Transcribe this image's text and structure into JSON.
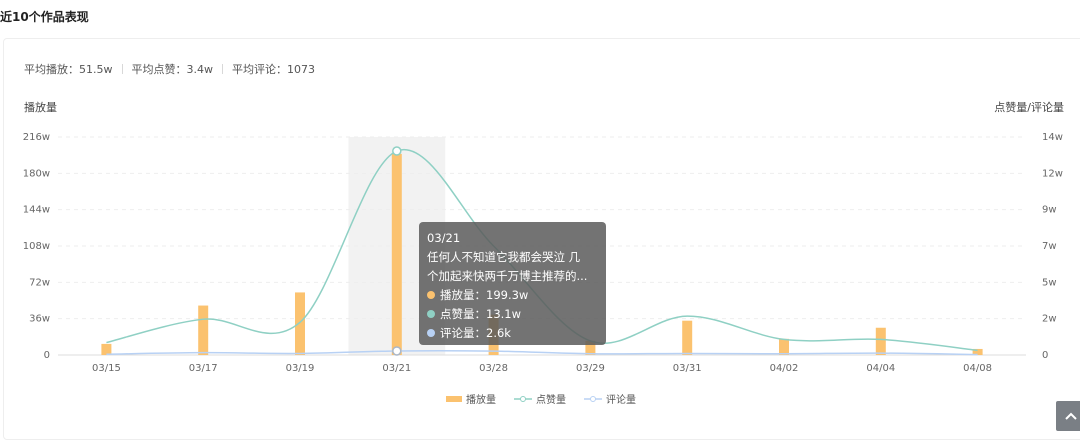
{
  "section_title": "近10个作品表现",
  "stats": {
    "avg_play": "平均播放：51.5w",
    "avg_like": "平均点赞：3.4w",
    "avg_comment": "平均评论：1073"
  },
  "left_axis_title": "播放量",
  "right_axis_title": "点赞量/评论量",
  "colors": {
    "play": "#fbc26f",
    "like": "#8fd0c4",
    "comment": "#b8d1f4"
  },
  "chart_data": {
    "type": "bar",
    "categories": [
      "03/15",
      "03/17",
      "03/19",
      "03/21",
      "03/28",
      "03/29",
      "03/31",
      "04/02",
      "04/04",
      "04/08"
    ],
    "series": [
      {
        "name": "播放量",
        "axis": "left",
        "type": "bar",
        "values": [
          11,
          49,
          62,
          199.3,
          40,
          14,
          34,
          16,
          27,
          6
        ]
      },
      {
        "name": "点赞量",
        "axis": "right",
        "type": "line",
        "values": [
          0.8,
          2.3,
          2.1,
          13.1,
          7.0,
          0.9,
          2.5,
          1.0,
          1.0,
          0.3
        ]
      },
      {
        "name": "评论量",
        "axis": "right",
        "type": "line",
        "values": [
          0.05,
          0.15,
          0.1,
          0.26,
          0.25,
          0.08,
          0.1,
          0.08,
          0.12,
          0.03
        ]
      }
    ],
    "left_ticks": [
      "0",
      "36w",
      "72w",
      "108w",
      "144w",
      "180w",
      "216w"
    ],
    "right_ticks": [
      "0",
      "2w",
      "5w",
      "7w",
      "9w",
      "12w",
      "14w"
    ],
    "ylim_left": [
      0,
      216
    ],
    "ylim_right": [
      0,
      14
    ],
    "highlight_category": "03/21",
    "legend_position": "bottom"
  },
  "tooltip": {
    "date": "03/21",
    "title_line1": "任何人不知道它我都会哭泣 几",
    "title_line2": "个加起来快两千万博主推荐的...",
    "play": "播放量：199.3w",
    "like": "点赞量：13.1w",
    "comment": "评论量：2.6k"
  },
  "legend": {
    "play": "播放量",
    "like": "点赞量",
    "comment": "评论量"
  }
}
